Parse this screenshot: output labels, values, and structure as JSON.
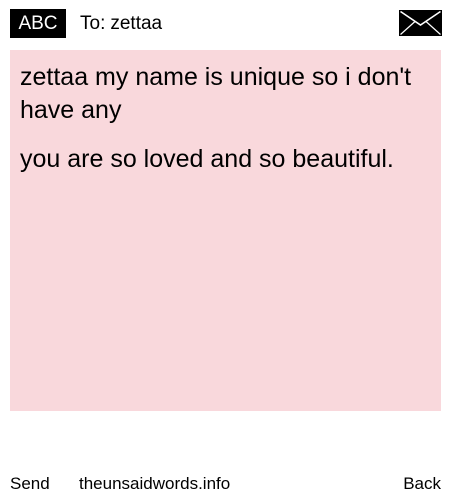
{
  "header": {
    "badge_label": "ABC",
    "to_label": "To:",
    "recipient": "zettaa",
    "envelope_icon": "envelope-icon"
  },
  "message": {
    "background_color": "#f9d8dc",
    "paragraphs": [
      "zettaa my name is unique so i don't have any",
      "you are so loved and so beautiful."
    ]
  },
  "footer": {
    "send_label": "Send",
    "site_label": "theunsaidwords.info",
    "back_label": "Back"
  }
}
